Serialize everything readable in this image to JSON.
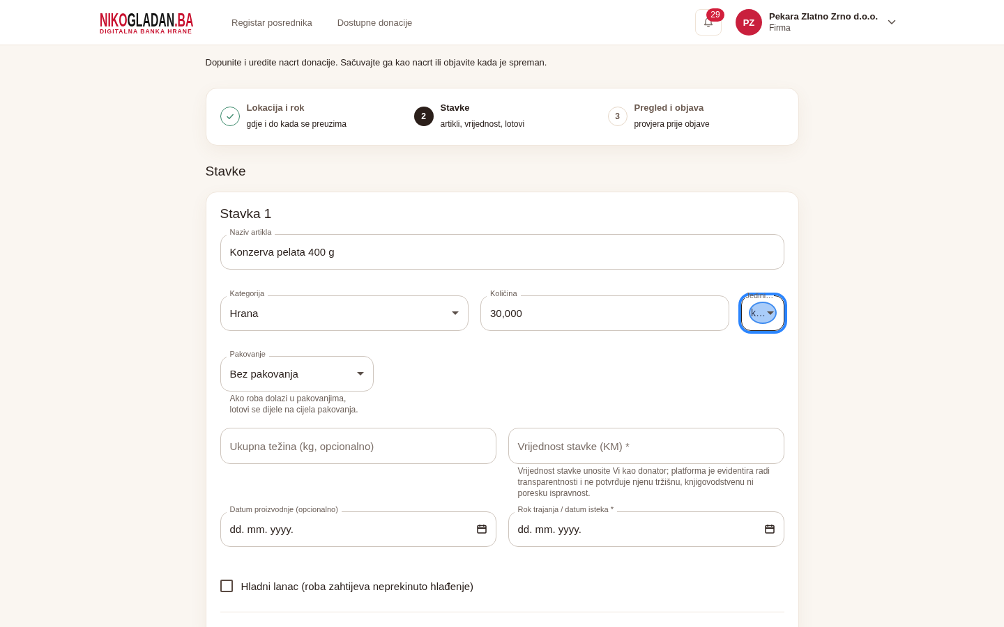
{
  "header": {
    "logo": {
      "parts": [
        {
          "text": "NIKO",
          "color": "#c8102e"
        },
        {
          "text": "GLADAN",
          "color": "#141414"
        },
        {
          "text": ".BA",
          "color": "#c8102e"
        }
      ],
      "tagline": "DIGITALNA BANKA HRANE"
    },
    "nav": [
      {
        "label": "Registar posrednika"
      },
      {
        "label": "Dostupne donacije"
      }
    ],
    "notifications": {
      "count": "29"
    },
    "account": {
      "initials": "PZ",
      "name": "Pekara Zlatno Zrno d.o.o.",
      "role": "Firma"
    }
  },
  "page": {
    "subtitle": "Dopunite i uredite nacrt donacije. Sačuvajte ga kao nacrt ili objavite kada je spreman."
  },
  "stepper": [
    {
      "title": "Lokacija i rok",
      "subtitle": "gdje i do kada se preuzima",
      "done": true,
      "selected": false
    },
    {
      "number": "2",
      "title": "Stavke",
      "subtitle": "artikli, vrijednost, lotovi",
      "done": false,
      "selected": true
    },
    {
      "number": "3",
      "title": "Pregled i objava",
      "subtitle": "provjera prije objave",
      "done": false,
      "selected": false
    }
  ],
  "section_title": "Stavke",
  "items": [
    {
      "title": "Stavka 1",
      "rows": [
        [
          {
            "kind": "text",
            "label": "Naziv artikla",
            "value": "Konzerva pelata 400 g",
            "focused": false
          }
        ],
        [
          {
            "kind": "select",
            "label": "Kategorija",
            "value": "Hrana",
            "focused": false
          },
          {
            "kind": "text",
            "label": "Količina",
            "value": "30,000",
            "focused": false
          },
          {
            "kind": "select",
            "label": "Jedini…",
            "value": "k…",
            "focused": true
          }
        ],
        [
          {
            "kind": "select",
            "label": "Pakovanje",
            "value": "Bez pakovanja",
            "helper": "Ako roba dolazi u pakovanjima, lotovi se dijele na cijela pakovanja.",
            "focused": false
          }
        ],
        [
          {
            "kind": "text",
            "placeholder": "Ukupna težina (kg, opcionalno)",
            "focused": false
          },
          {
            "kind": "text",
            "placeholder": "Vrijednost stavke (KM) *",
            "helper": "Vrijednost stavke unosite Vi kao donator; platforma je evidentira radi transparentnosti i ne potvrđuje njenu tržišnu, knjigovodstvenu ni poresku ispravnost.",
            "focused": false
          }
        ],
        [
          {
            "kind": "date",
            "label": "Datum proizvodnje (opcionalno)",
            "placeholder": "dd. mm. yyyy.",
            "focused": false
          },
          {
            "kind": "date",
            "label": "Rok trajanja / datum isteka *",
            "placeholder": "dd. mm. yyyy.",
            "focused": false
          }
        ]
      ],
      "checkboxes": [
        {
          "label": "Hladni lanac (roba zahtijeva neprekinuto hlađenje)",
          "checked": false
        }
      ]
    }
  ]
}
